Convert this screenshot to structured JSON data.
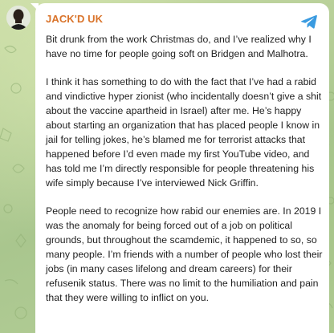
{
  "channel": {
    "name": "JACK'D UK"
  },
  "message": {
    "paragraphs": [
      "Bit drunk from the work Christmas do, and I’ve realized why I have no time for people going soft on Bridgen and Malhotra.",
      "I think it has something to do with the fact that I’ve had a rabid and vindictive hyper zionist (who incidentally doesn’t give a shit about the vaccine apartheid in Israel) after me. He’s happy about starting an organization that has placed people I know in jail for telling jokes, he’s blamed me for terrorist attacks that happened before I’d even made my first YouTube video, and has told me I’m directly responsible for people threatening his wife simply because I’ve interviewed Nick Griffin.",
      "People need to recognize how rabid our enemies are. In 2019 I was the anomaly for being forced out of a job on political grounds, but throughout the scamdemic, it happened to so, so many people. I’m friends with a number of people who lost their jobs (in many cases lifelong and dream careers) for their refusenik status. There was no limit to the humiliation and pain that they were willing to inflict on you."
    ]
  },
  "icons": {
    "share": "telegram-plane-icon",
    "avatar": "avatar-photo"
  },
  "colors": {
    "channel_name": "#d9732a",
    "share_icon": "#3a9be0",
    "bubble": "#ffffff",
    "text": "#1f1f1f",
    "chat_background": "#b8cf9a"
  }
}
